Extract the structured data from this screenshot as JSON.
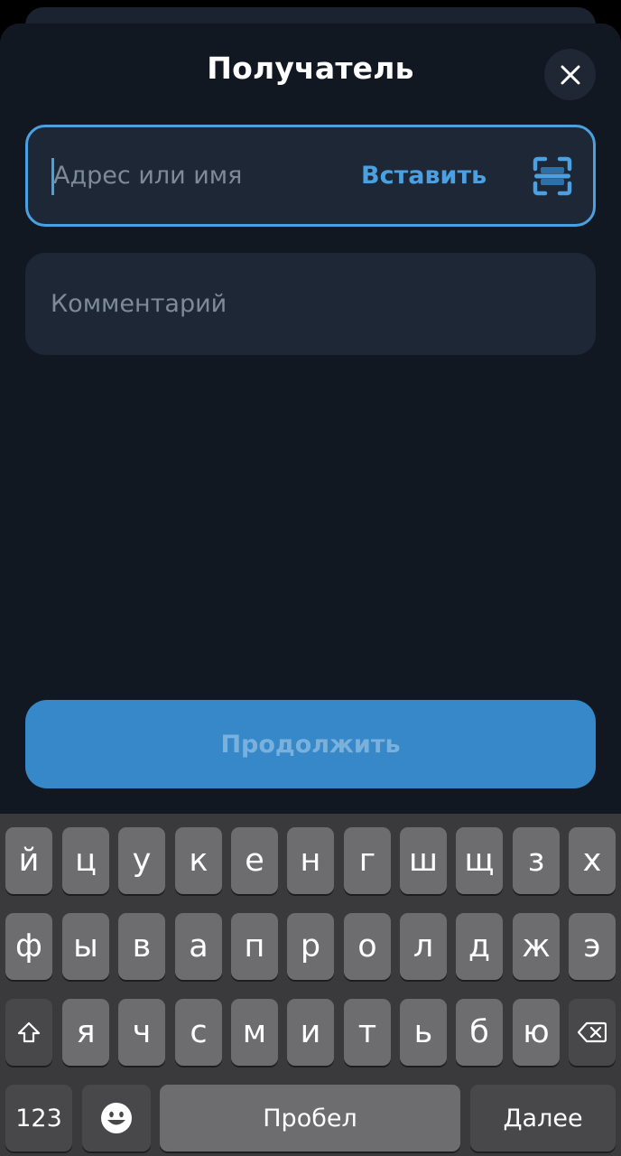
{
  "sheet": {
    "title": "Получатель",
    "close_icon": "close-icon"
  },
  "address": {
    "placeholder": "Адрес или имя",
    "paste_label": "Вставить",
    "scan_icon": "qr-scan-icon"
  },
  "comment": {
    "placeholder": "Комментарий"
  },
  "continue_label": "Продолжить",
  "colors": {
    "accent": "#4aa0e0",
    "button": "#3688c8",
    "background": "#121822",
    "field": "#1e2735"
  },
  "keyboard": {
    "row1": [
      "й",
      "ц",
      "у",
      "к",
      "е",
      "н",
      "г",
      "ш",
      "щ",
      "з",
      "х"
    ],
    "row2": [
      "ф",
      "ы",
      "в",
      "а",
      "п",
      "р",
      "о",
      "л",
      "д",
      "ж",
      "э"
    ],
    "row3": [
      "я",
      "ч",
      "с",
      "м",
      "и",
      "т",
      "ь",
      "б",
      "ю"
    ],
    "shift_icon": "shift-icon",
    "backspace_icon": "backspace-icon",
    "numbers_label": "123",
    "emoji_icon": "emoji-icon",
    "space_label": "Пробел",
    "return_label": "Далее"
  }
}
